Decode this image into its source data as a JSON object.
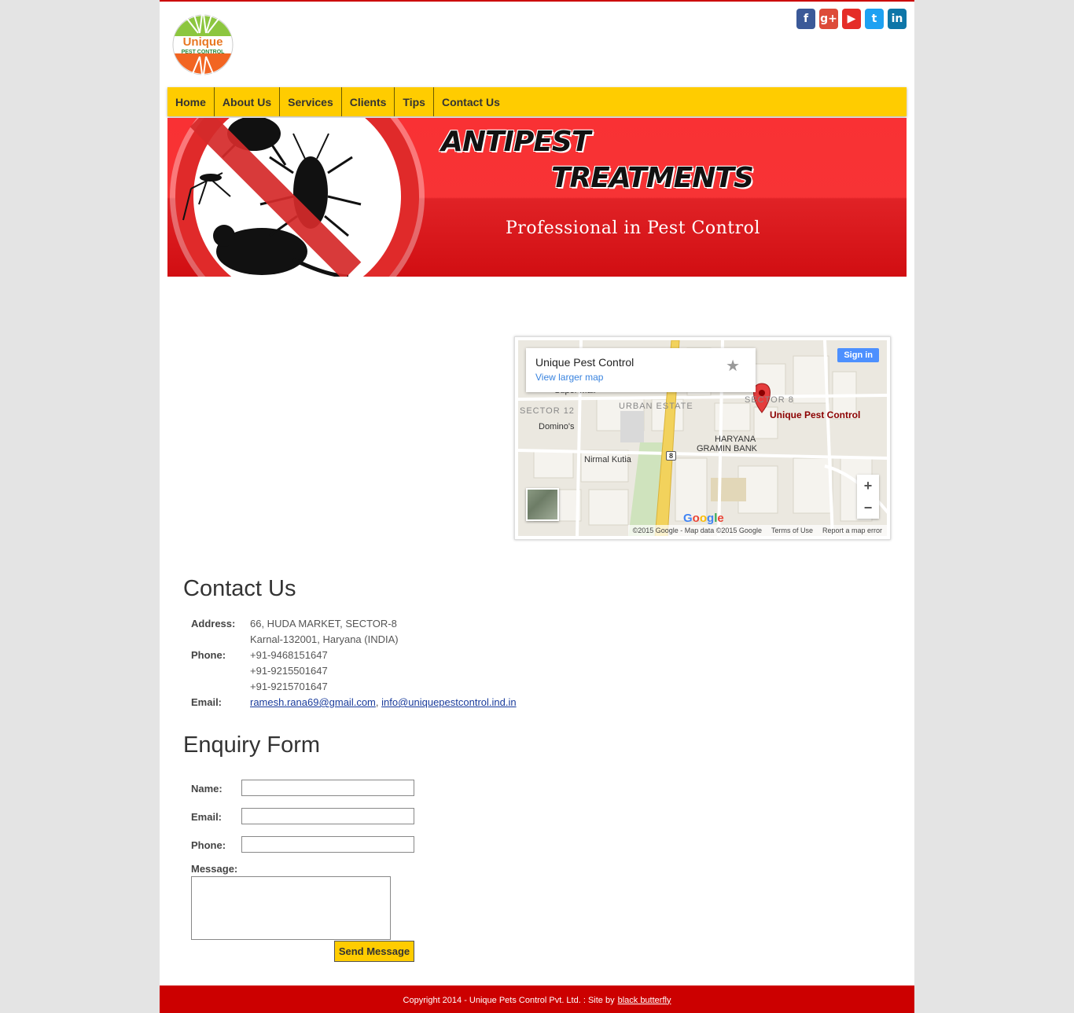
{
  "brand": {
    "logo_word": "Unique",
    "logo_sub": "PEST CONTROL"
  },
  "social": [
    {
      "name": "facebook-icon",
      "glyph": "f",
      "color": "#3b5998"
    },
    {
      "name": "google-plus-icon",
      "glyph": "g+",
      "color": "#dd4b39"
    },
    {
      "name": "youtube-icon",
      "glyph": "▶",
      "color": "#e52d27"
    },
    {
      "name": "twitter-icon",
      "glyph": "t",
      "color": "#1da1f2"
    },
    {
      "name": "linkedin-icon",
      "glyph": "in",
      "color": "#0e76a8"
    }
  ],
  "nav": {
    "items": [
      "Home",
      "About Us",
      "Services",
      "Clients",
      "Tips",
      "Contact Us"
    ]
  },
  "banner": {
    "title1": "ANTIPEST",
    "title2": "TREATMENTS",
    "subtitle": "Professional in Pest Control"
  },
  "map": {
    "place_name": "Unique Pest Control",
    "larger_map": "View larger map",
    "sign_in": "Sign in",
    "pin_label": "Unique Pest Control",
    "labels": {
      "super_mall": "Super Mall",
      "sector12": "SECTOR 12",
      "dominos": "Domino's",
      "urban_estate": "URBAN ESTATE",
      "sector8": "SECTOR 8",
      "haryana1": "HARYANA",
      "haryana2": "GRAMIN BANK",
      "nirmal": "Nirmal Kutia",
      "highway": "8"
    },
    "google": "Google",
    "copyright": "©2015 Google - Map data ©2015 Google",
    "terms": "Terms of Use",
    "report": "Report a map error"
  },
  "contact": {
    "heading": "Contact Us",
    "address_label": "Address:",
    "address_line1": "66, HUDA MARKET, SECTOR-8",
    "address_line2": "Karnal-132001, Haryana (INDIA)",
    "phone_label": "Phone:",
    "phones": [
      "+91-9468151647",
      "+91-9215501647",
      "+91-9215701647"
    ],
    "email_label": "Email:",
    "email1": "ramesh.rana69@gmail.com",
    "email2": "info@uniquepestcontrol.ind.in"
  },
  "form": {
    "heading": "Enquiry Form",
    "name_label": "Name:",
    "email_label": "Email:",
    "phone_label": "Phone:",
    "message_label": "Message:",
    "send_label": "Send Message"
  },
  "footer": {
    "text": "Copyright 2014 - Unique Pets Control Pvt. Ltd. : Site by",
    "link": "black butterfly"
  }
}
